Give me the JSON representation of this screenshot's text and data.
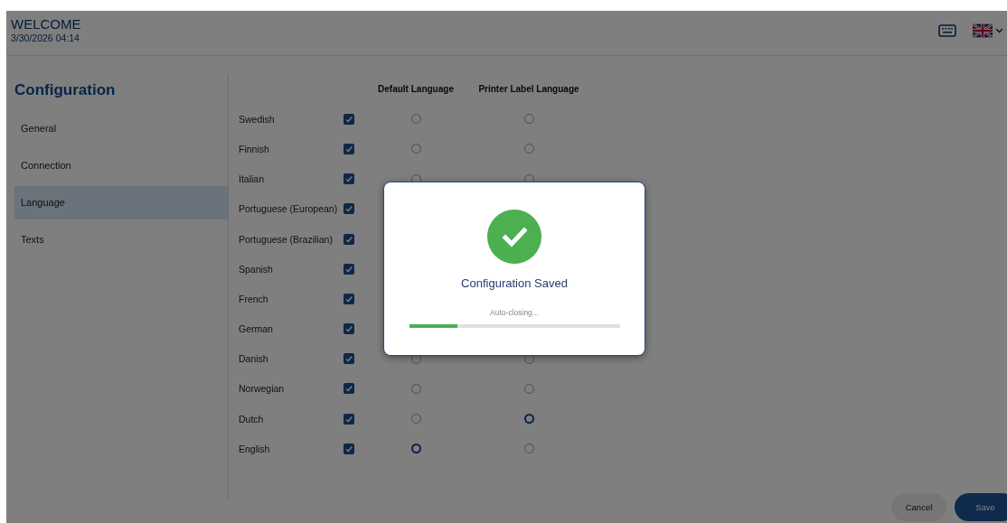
{
  "header": {
    "title": "WELCOME",
    "datetime": "3/30/2026 04:14"
  },
  "sidebar": {
    "title": "Configuration",
    "items": [
      {
        "label": "General",
        "selected": false
      },
      {
        "label": "Connection",
        "selected": false
      },
      {
        "label": "Language",
        "selected": true
      },
      {
        "label": "Texts",
        "selected": false
      }
    ]
  },
  "table": {
    "columns": [
      "Default Language",
      "Printer Label Language"
    ],
    "rows": [
      {
        "language": "Swedish",
        "enabled": true,
        "default": false,
        "printer_label": false
      },
      {
        "language": "Finnish",
        "enabled": true,
        "default": false,
        "printer_label": false
      },
      {
        "language": "Italian",
        "enabled": true,
        "default": false,
        "printer_label": false
      },
      {
        "language": "Portuguese (European)",
        "enabled": true
      },
      {
        "language": "Portuguese (Brazilian)",
        "enabled": true
      },
      {
        "language": "Spanish",
        "enabled": true
      },
      {
        "language": "French",
        "enabled": true
      },
      {
        "language": "German",
        "enabled": true
      },
      {
        "language": "Danish",
        "enabled": true,
        "default": false,
        "printer_label": false
      },
      {
        "language": "Norwegian",
        "enabled": true,
        "default": false,
        "printer_label": false
      },
      {
        "language": "Dutch",
        "enabled": true,
        "default": false,
        "printer_label": true
      },
      {
        "language": "English",
        "enabled": true,
        "default": true,
        "printer_label": false
      }
    ]
  },
  "footer": {
    "buttons": [
      {
        "label": "Cancel",
        "kind": "secondary"
      },
      {
        "label": "Save",
        "kind": "primary"
      }
    ]
  },
  "dialog": {
    "message": "Configuration Saved",
    "status": "Auto-closing...",
    "progress": {
      "level": 0.23
    }
  }
}
